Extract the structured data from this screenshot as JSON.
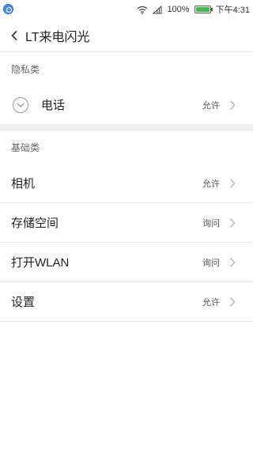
{
  "status_bar": {
    "battery": "100%",
    "battery_level": 1.0,
    "time": "下午4:31"
  },
  "header": {
    "title": "LT来电闪光"
  },
  "sections": [
    {
      "title": "隐私类",
      "items": [
        {
          "label": "电话",
          "status": "允许"
        }
      ]
    },
    {
      "title": "基础类",
      "items": [
        {
          "label": "相机",
          "status": "允许"
        },
        {
          "label": "存储空间",
          "status": "询问"
        },
        {
          "label": "打开WLAN",
          "status": "询问"
        },
        {
          "label": "设置",
          "status": "允许"
        }
      ]
    }
  ]
}
